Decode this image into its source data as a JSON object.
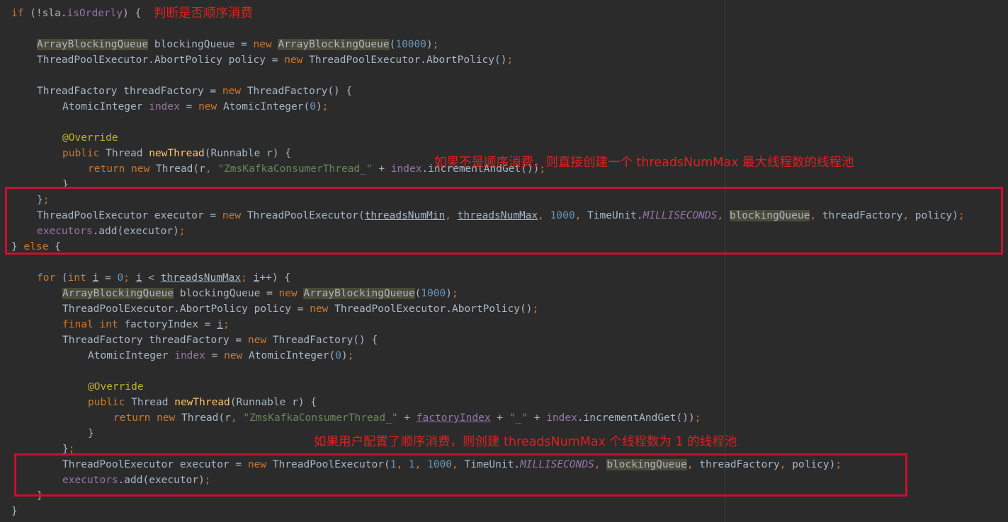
{
  "code_lines": [
    [
      {
        "t": "if (",
        "c": "kw-mixed-1"
      },
      {
        "t": "!sla.",
        "c": "plain"
      },
      {
        "t": "isOrderly",
        "c": "field"
      },
      {
        "t": ") {",
        "c": "plain"
      }
    ],
    [],
    [
      {
        "t": "ArrayBlockingQueue",
        "c": "plain hl"
      },
      {
        "t": " blockingQueue = ",
        "c": "plain"
      },
      {
        "t": "new ",
        "c": "kw"
      },
      {
        "t": "ArrayBlockingQueue",
        "c": "plain hl"
      },
      {
        "t": "(",
        "c": "plain"
      },
      {
        "t": "10000",
        "c": "num"
      },
      {
        "t": ")",
        "c": "plain"
      },
      {
        "t": ";",
        "c": "kw"
      }
    ],
    [
      {
        "t": "ThreadPoolExecutor.AbortPolicy policy = ",
        "c": "plain"
      },
      {
        "t": "new ",
        "c": "kw"
      },
      {
        "t": "ThreadPoolExecutor.AbortPolicy()",
        "c": "plain"
      },
      {
        "t": ";",
        "c": "kw"
      }
    ],
    [],
    [
      {
        "t": "ThreadFactory threadFactory = ",
        "c": "plain"
      },
      {
        "t": "new ",
        "c": "kw"
      },
      {
        "t": "ThreadFactory() {",
        "c": "plain"
      }
    ],
    [
      {
        "t": "AtomicInteger ",
        "c": "plain"
      },
      {
        "t": "index",
        "c": "field"
      },
      {
        "t": " = ",
        "c": "plain"
      },
      {
        "t": "new ",
        "c": "kw"
      },
      {
        "t": "AtomicInteger(",
        "c": "plain"
      },
      {
        "t": "0",
        "c": "num"
      },
      {
        "t": ")",
        "c": "plain"
      },
      {
        "t": ";",
        "c": "kw"
      }
    ],
    [],
    [
      {
        "t": "@Override",
        "c": "ann"
      }
    ],
    [
      {
        "t": "public ",
        "c": "kw"
      },
      {
        "t": "Thread ",
        "c": "plain"
      },
      {
        "t": "newThread",
        "c": "method"
      },
      {
        "t": "(Runnable r) {",
        "c": "plain"
      }
    ],
    [
      {
        "t": "return new ",
        "c": "kw"
      },
      {
        "t": "Thread(r",
        "c": "plain"
      },
      {
        "t": ", ",
        "c": "kw"
      },
      {
        "t": "\"ZmsKafkaConsumerThread_\"",
        "c": "str"
      },
      {
        "t": " + ",
        "c": "plain"
      },
      {
        "t": "index",
        "c": "field"
      },
      {
        "t": ".incrementAndGet())",
        "c": "plain"
      },
      {
        "t": ";",
        "c": "kw"
      }
    ],
    [
      {
        "t": "}",
        "c": "plain"
      }
    ],
    [
      {
        "t": "}",
        "c": "plain"
      },
      {
        "t": ";",
        "c": "kw"
      }
    ],
    [
      {
        "t": "ThreadPoolExecutor executor = ",
        "c": "plain"
      },
      {
        "t": "new ",
        "c": "kw"
      },
      {
        "t": "ThreadPoolExecutor(",
        "c": "plain"
      },
      {
        "t": "threadsNumMin",
        "c": "plain ul"
      },
      {
        "t": ", ",
        "c": "kw"
      },
      {
        "t": "threadsNumMax",
        "c": "plain ul"
      },
      {
        "t": ", ",
        "c": "kw"
      },
      {
        "t": "1000",
        "c": "num"
      },
      {
        "t": ", ",
        "c": "kw"
      },
      {
        "t": "TimeUnit.",
        "c": "plain"
      },
      {
        "t": "MILLISECONDS",
        "c": "staticf"
      },
      {
        "t": ", ",
        "c": "kw"
      },
      {
        "t": "blockingQueue",
        "c": "plain hl"
      },
      {
        "t": ", ",
        "c": "kw"
      },
      {
        "t": "threadFactory",
        "c": "plain"
      },
      {
        "t": ", ",
        "c": "kw"
      },
      {
        "t": "policy)",
        "c": "plain"
      },
      {
        "t": ";",
        "c": "kw"
      }
    ],
    [
      {
        "t": "executors",
        "c": "field"
      },
      {
        "t": ".add(executor)",
        "c": "plain"
      },
      {
        "t": ";",
        "c": "kw"
      }
    ],
    [
      {
        "t": "} ",
        "c": "plain"
      },
      {
        "t": "else ",
        "c": "kw"
      },
      {
        "t": "{",
        "c": "plain"
      }
    ],
    [],
    [
      {
        "t": "for ",
        "c": "kw"
      },
      {
        "t": "(",
        "c": "plain"
      },
      {
        "t": "int ",
        "c": "kw"
      },
      {
        "t": "i",
        "c": "plain ul"
      },
      {
        "t": " = ",
        "c": "plain"
      },
      {
        "t": "0",
        "c": "num"
      },
      {
        "t": "; ",
        "c": "kw"
      },
      {
        "t": "i",
        "c": "plain ul"
      },
      {
        "t": " < ",
        "c": "plain"
      },
      {
        "t": "threadsNumMax",
        "c": "plain ul"
      },
      {
        "t": "; ",
        "c": "kw"
      },
      {
        "t": "i",
        "c": "plain ul"
      },
      {
        "t": "++) {",
        "c": "plain"
      }
    ],
    [
      {
        "t": "ArrayBlockingQueue",
        "c": "plain hl"
      },
      {
        "t": " blockingQueue = ",
        "c": "plain"
      },
      {
        "t": "new ",
        "c": "kw"
      },
      {
        "t": "ArrayBlockingQueue",
        "c": "plain hl"
      },
      {
        "t": "(",
        "c": "plain"
      },
      {
        "t": "1000",
        "c": "num"
      },
      {
        "t": ")",
        "c": "plain"
      },
      {
        "t": ";",
        "c": "kw"
      }
    ],
    [
      {
        "t": "ThreadPoolExecutor.AbortPolicy policy = ",
        "c": "plain"
      },
      {
        "t": "new ",
        "c": "kw"
      },
      {
        "t": "ThreadPoolExecutor.AbortPolicy()",
        "c": "plain"
      },
      {
        "t": ";",
        "c": "kw"
      }
    ],
    [
      {
        "t": "final int ",
        "c": "kw"
      },
      {
        "t": "factoryIndex = ",
        "c": "plain"
      },
      {
        "t": "i",
        "c": "plain ul"
      },
      {
        "t": ";",
        "c": "kw"
      }
    ],
    [
      {
        "t": "ThreadFactory threadFactory = ",
        "c": "plain"
      },
      {
        "t": "new ",
        "c": "kw"
      },
      {
        "t": "ThreadFactory() {",
        "c": "plain"
      }
    ],
    [
      {
        "t": "AtomicInteger ",
        "c": "plain"
      },
      {
        "t": "index",
        "c": "field"
      },
      {
        "t": " = ",
        "c": "plain"
      },
      {
        "t": "new ",
        "c": "kw"
      },
      {
        "t": "AtomicInteger(",
        "c": "plain"
      },
      {
        "t": "0",
        "c": "num"
      },
      {
        "t": ")",
        "c": "plain"
      },
      {
        "t": ";",
        "c": "kw"
      }
    ],
    [],
    [
      {
        "t": "@Override",
        "c": "ann"
      }
    ],
    [
      {
        "t": "public ",
        "c": "kw"
      },
      {
        "t": "Thread ",
        "c": "plain"
      },
      {
        "t": "newThread",
        "c": "method"
      },
      {
        "t": "(Runnable r) {",
        "c": "plain"
      }
    ],
    [
      {
        "t": "return new ",
        "c": "kw"
      },
      {
        "t": "Thread(r",
        "c": "plain"
      },
      {
        "t": ", ",
        "c": "kw"
      },
      {
        "t": "\"ZmsKafkaConsumerThread_\"",
        "c": "str"
      },
      {
        "t": " + ",
        "c": "plain"
      },
      {
        "t": "factoryIndex",
        "c": "field ulf"
      },
      {
        "t": " + ",
        "c": "plain"
      },
      {
        "t": "\"_\"",
        "c": "str"
      },
      {
        "t": " + ",
        "c": "plain"
      },
      {
        "t": "index",
        "c": "field"
      },
      {
        "t": ".incrementAndGet())",
        "c": "plain"
      },
      {
        "t": ";",
        "c": "kw"
      }
    ],
    [
      {
        "t": "}",
        "c": "plain"
      }
    ],
    [
      {
        "t": "}",
        "c": "plain"
      },
      {
        "t": ";",
        "c": "kw"
      }
    ],
    [
      {
        "t": "ThreadPoolExecutor executor = ",
        "c": "plain"
      },
      {
        "t": "new ",
        "c": "kw"
      },
      {
        "t": "ThreadPoolExecutor(",
        "c": "plain"
      },
      {
        "t": "1",
        "c": "num"
      },
      {
        "t": ", ",
        "c": "kw"
      },
      {
        "t": "1",
        "c": "num"
      },
      {
        "t": ", ",
        "c": "kw"
      },
      {
        "t": "1000",
        "c": "num"
      },
      {
        "t": ", ",
        "c": "kw"
      },
      {
        "t": "TimeUnit.",
        "c": "plain"
      },
      {
        "t": "MILLISECONDS",
        "c": "staticf"
      },
      {
        "t": ", ",
        "c": "kw"
      },
      {
        "t": "blockingQueue",
        "c": "plain hl"
      },
      {
        "t": ", ",
        "c": "kw"
      },
      {
        "t": "threadFactory",
        "c": "plain"
      },
      {
        "t": ", ",
        "c": "kw"
      },
      {
        "t": "policy)",
        "c": "plain"
      },
      {
        "t": ";",
        "c": "kw"
      }
    ],
    [
      {
        "t": "executors",
        "c": "field"
      },
      {
        "t": ".add(executor)",
        "c": "plain"
      },
      {
        "t": ";",
        "c": "kw"
      }
    ],
    [
      {
        "t": "}",
        "c": "plain"
      }
    ],
    [
      {
        "t": "}",
        "c": "plain"
      }
    ]
  ],
  "annotations": {
    "orderly_check": "判断是否顺序消费",
    "not_orderly": "如果不是顺序消费，则直接创建一个 threadsNumMax 最大线程数的线程池",
    "orderly": "如果用户配置了顺序消费，则创建 threadsNumMax 个线程数为 1 的线程池"
  },
  "colors": {
    "background": "#2b2b2b",
    "keyword": "#cc7832",
    "number": "#6897bb",
    "string": "#6a8759",
    "field": "#9876aa",
    "annotation": "#bbb529",
    "method": "#ffc66d",
    "text": "#a9b7c6",
    "highlight_box": "#c8102e"
  }
}
